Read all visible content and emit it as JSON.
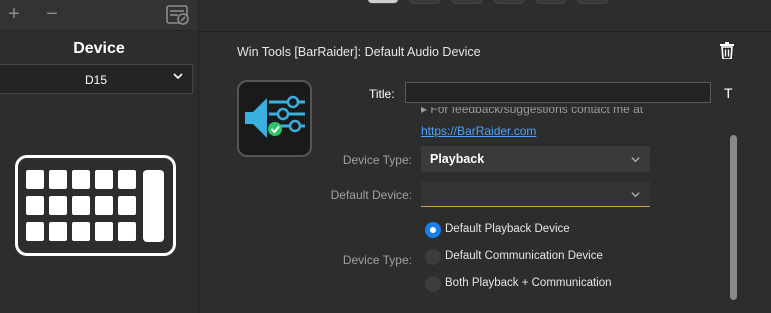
{
  "toolbar": {
    "add_symbol": "+",
    "remove_symbol": "−",
    "store_icon": "store-icon"
  },
  "left_panel": {
    "heading": "Device",
    "device_select": {
      "value": "D15"
    }
  },
  "header": {
    "action_title": "Win Tools [BarRaider]: Default Audio Device"
  },
  "form": {
    "title_label": "Title:",
    "title_value": "",
    "title_font_icon": "T",
    "info_line": "▸  For feedback/suggestions contact me at",
    "info_link": "https://BarRaider.com",
    "device_type_label": "Device Type:",
    "device_type_value": "Playback",
    "default_device_label": "Default Device:",
    "default_device_value": "",
    "device_type_label_2": "Device Type:",
    "radio_options": [
      {
        "label": "Default Playback Device",
        "checked": true
      },
      {
        "label": "Default Communication Device",
        "checked": false
      },
      {
        "label": "Both Playback + Communication",
        "checked": false
      }
    ]
  },
  "colors": {
    "accent": "#1a7fe8",
    "underline": "#d4a23a",
    "link": "#4ea3ff",
    "icon_blue": "#3ab0e0",
    "icon_green": "#2ec46a"
  }
}
